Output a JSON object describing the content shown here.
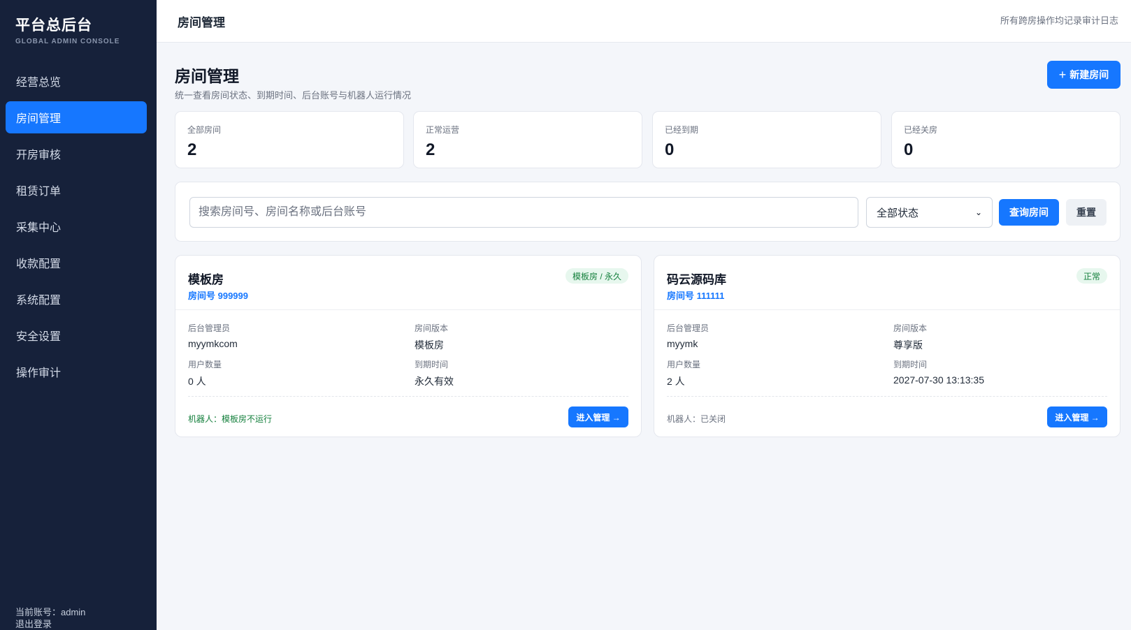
{
  "sidebar": {
    "brand_title": "平台总后台",
    "brand_subtitle": "GLOBAL ADMIN CONSOLE",
    "items": [
      {
        "label": "经营总览",
        "active": false
      },
      {
        "label": "房间管理",
        "active": true
      },
      {
        "label": "开房审核",
        "active": false
      },
      {
        "label": "租赁订单",
        "active": false
      },
      {
        "label": "采集中心",
        "active": false
      },
      {
        "label": "收款配置",
        "active": false
      },
      {
        "label": "系统配置",
        "active": false
      },
      {
        "label": "安全设置",
        "active": false
      },
      {
        "label": "操作审计",
        "active": false
      }
    ],
    "account_text": "当前账号：admin",
    "logout_label": "退出登录"
  },
  "topbar": {
    "title": "房间管理",
    "note": "所有跨房操作均记录审计日志"
  },
  "header": {
    "title": "房间管理",
    "description": "统一查看房间状态、到期时间、后台账号与机器人运行情况",
    "new_button": "新建房间"
  },
  "stats": [
    {
      "label": "全部房间",
      "value": "2"
    },
    {
      "label": "正常运营",
      "value": "2"
    },
    {
      "label": "已经到期",
      "value": "0"
    },
    {
      "label": "已经关房",
      "value": "0"
    }
  ],
  "filter": {
    "search_placeholder": "搜索房间号、房间名称或后台账号",
    "status_selected": "全部状态",
    "query_button": "查询房间",
    "reset_button": "重置"
  },
  "rooms": [
    {
      "name": "模板房",
      "number": "房间号 999999",
      "badge": "模板房 / 永久",
      "admin_label": "后台管理员",
      "admin": "myymkcom",
      "version_label": "房间版本",
      "version": "模板房",
      "users_label": "用户数量",
      "users": "0 人",
      "expire_label": "到期时间",
      "expire": "永久有效",
      "robot": "机器人：模板房不运行",
      "enter_button": "进入管理 →"
    },
    {
      "name": "码云源码库",
      "number": "房间号 111111",
      "badge": "正常",
      "admin_label": "后台管理员",
      "admin": "myymk",
      "version_label": "房间版本",
      "version": "尊享版",
      "users_label": "用户数量",
      "users": "2 人",
      "expire_label": "到期时间",
      "expire": "2027-07-30 13:13:35",
      "robot": "机器人：已关闭",
      "enter_button": "进入管理 →"
    }
  ],
  "colors": {
    "sidebar_bg": "#16213a",
    "accent": "#1677ff",
    "success": "#15803d",
    "page_bg": "#f4f6fa"
  }
}
